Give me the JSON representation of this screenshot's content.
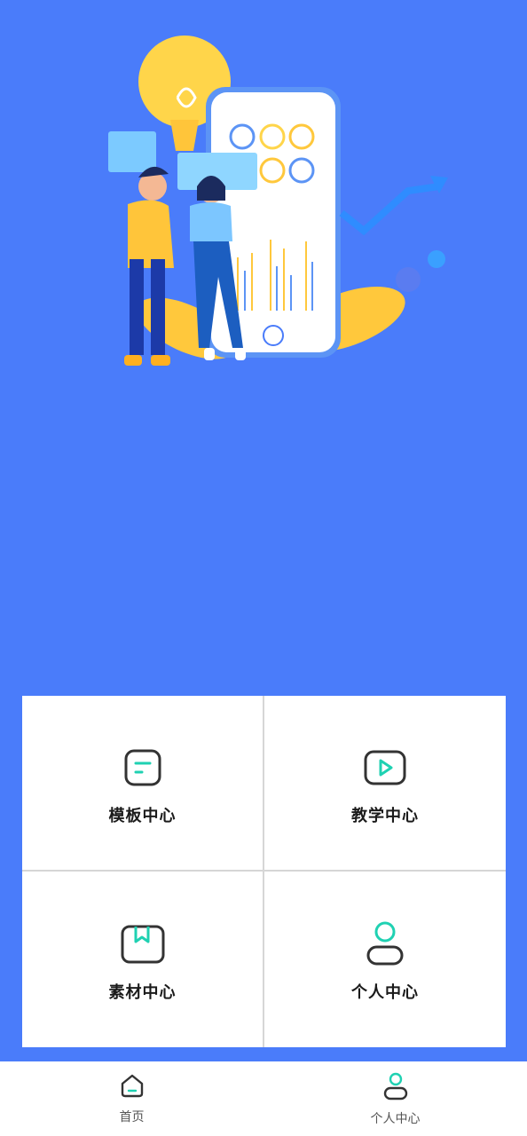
{
  "colors": {
    "background": "#4a7cfa",
    "accent": "#1fd1b2",
    "icon_stroke": "#333333"
  },
  "grid": {
    "items": [
      {
        "label": "模板中心",
        "icon": "template-icon"
      },
      {
        "label": "教学中心",
        "icon": "play-video-icon"
      },
      {
        "label": "素材中心",
        "icon": "bookmark-folder-icon"
      },
      {
        "label": "个人中心",
        "icon": "person-icon"
      }
    ]
  },
  "tabbar": {
    "items": [
      {
        "label": "首页",
        "icon": "home-icon"
      },
      {
        "label": "个人中心",
        "icon": "person-icon"
      }
    ]
  }
}
